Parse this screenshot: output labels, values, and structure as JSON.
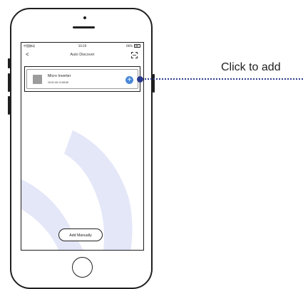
{
  "status_bar": {
    "carrier": "中国移动",
    "time": "10:20",
    "battery": "66%"
  },
  "nav": {
    "back": "<",
    "title": "Auto Discover",
    "scan_icon": "scan-qr-icon"
  },
  "device": {
    "name": "Micro Inverter",
    "mac": "28:6C:68:13:6B:88",
    "add_icon": "plus-icon"
  },
  "add_manually_label": "Add Manually",
  "callout": {
    "label": "Click to add"
  },
  "colors": {
    "accent": "#4a88d9",
    "callout": "#2a3a8c",
    "watermark": "#e4e7f8"
  }
}
